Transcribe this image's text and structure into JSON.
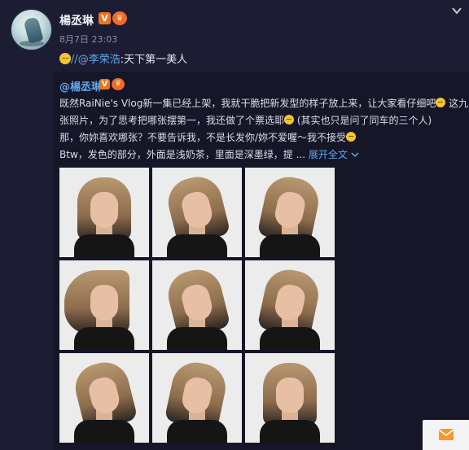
{
  "post": {
    "username": "楊丞琳",
    "verified_badge": "V",
    "timestamp": "8月7日 23:03",
    "comment": {
      "emoji": "smile-emoji",
      "mention": "//@李荣浩",
      "text": ":天下第一美人"
    }
  },
  "repost": {
    "author": "@楊丞琳",
    "verified_badge": "V",
    "lines": [
      "既然RaiNie's Vlog新一集已经上架，我就干脆把新发型的样子放上来，让大家看仔细吧",
      " 这九",
      "张照片，为了思考把哪张摆第一，我还做了个票选耶",
      " (其实也只是问了同车的三个人)",
      "那，你妳喜欢哪张？不要告诉我，不是长发你/妳不爱喔～我不接受",
      "Btw，发色的部分，外面是浅奶茶，里面是深墨绿，提 ... "
    ],
    "expand_label": "展开全文",
    "expand_icon": "chevron-down-icon",
    "photo_count": 9
  },
  "colors": {
    "background": "#1c1c33",
    "repost_background": "#161629",
    "link": "#5fa8e8",
    "badge": "#e8761e"
  }
}
